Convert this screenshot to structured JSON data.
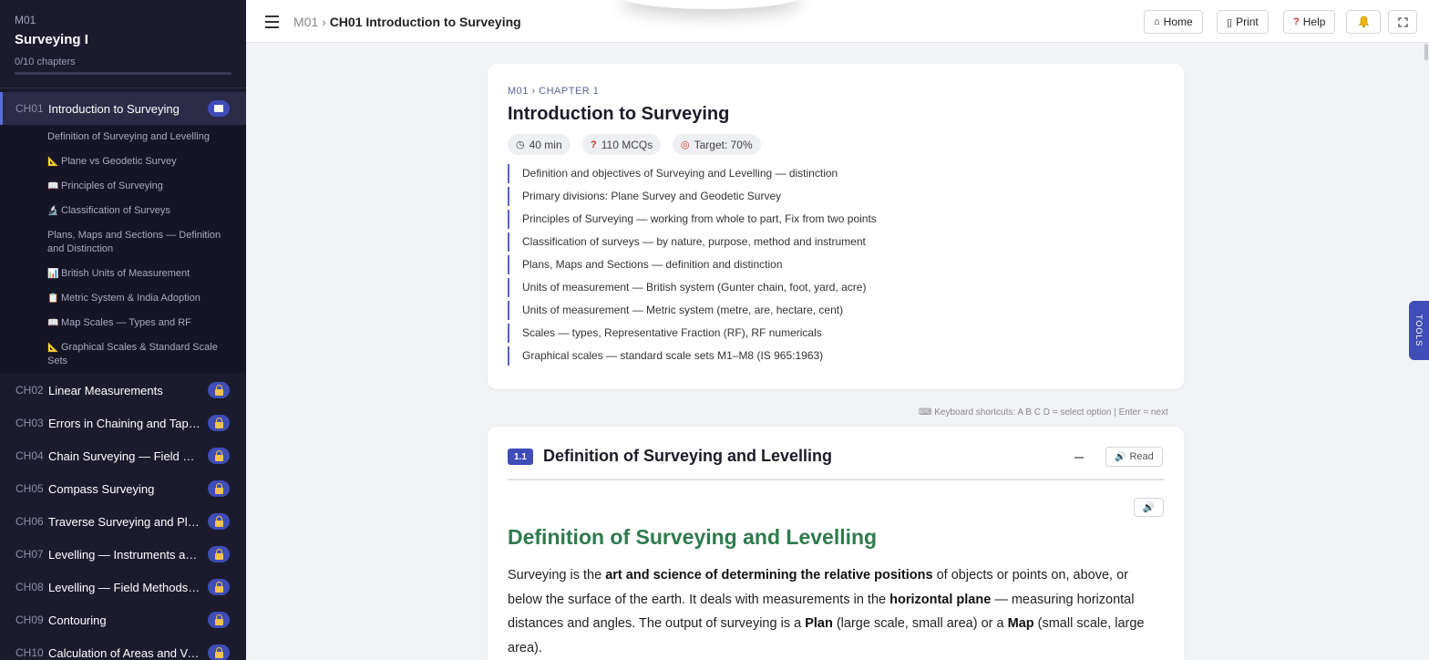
{
  "sidebar": {
    "module": "M01",
    "title": "Surveying I",
    "progress_text": "0/10 chapters",
    "progress_fraction": 0,
    "chapters": [
      {
        "code": "CH01",
        "label": "Introduction to Surveying",
        "badge": "book-icon",
        "active": true
      },
      {
        "code": "CH02",
        "label": "Linear Measurements",
        "badge": "lock-icon"
      },
      {
        "code": "CH03",
        "label": "Errors in Chaining and Tape C...",
        "badge": "lock-icon"
      },
      {
        "code": "CH04",
        "label": "Chain Surveying — Field Met...",
        "badge": "lock-icon"
      },
      {
        "code": "CH05",
        "label": "Compass Surveying",
        "badge": "lock-icon"
      },
      {
        "code": "CH06",
        "label": "Traverse Surveying and Plane ...",
        "badge": "lock-icon"
      },
      {
        "code": "CH07",
        "label": "Levelling — Instruments and ...",
        "badge": "lock-icon"
      },
      {
        "code": "CH08",
        "label": "Levelling — Field Methods an...",
        "badge": "lock-icon"
      },
      {
        "code": "CH09",
        "label": "Contouring",
        "badge": "lock-icon"
      },
      {
        "code": "CH10",
        "label": "Calculation of Areas and Volu...",
        "badge": "lock-icon"
      }
    ],
    "subtopics": [
      {
        "icon": "",
        "label": "Definition of Surveying and Levelling"
      },
      {
        "icon": "📐",
        "label": "Plane vs Geodetic Survey"
      },
      {
        "icon": "📖",
        "label": "Principles of Surveying"
      },
      {
        "icon": "🔬",
        "label": "Classification of Surveys"
      },
      {
        "icon": "",
        "label": "Plans, Maps and Sections — Definition and Distinction"
      },
      {
        "icon": "📊",
        "label": "British Units of Measurement"
      },
      {
        "icon": "📋",
        "label": "Metric System & India Adoption"
      },
      {
        "icon": "📖",
        "label": "Map Scales — Types and RF"
      },
      {
        "icon": "📐",
        "label": "Graphical Scales & Standard Scale Sets"
      }
    ]
  },
  "topbar": {
    "crumb_module": "M01",
    "crumb_sep": "›",
    "crumb_current": "CH01 Introduction to Surveying",
    "home": "Home",
    "print": "Print",
    "help": "Help",
    "icons": {
      "home": "home-icon",
      "print": "print-icon",
      "help": "help-icon",
      "bell": "bell-icon",
      "fullscreen": "fullscreen-icon"
    }
  },
  "tools_tab": "TOOLS",
  "chapter_card": {
    "kicker": "M01 › CHAPTER 1",
    "title": "Introduction to Surveying",
    "chips": {
      "duration": "40 min",
      "mcqs": "110 MCQs",
      "target": "Target: 70%"
    },
    "objectives": [
      "Definition and objectives of Surveying and Levelling — distinction",
      "Primary divisions: Plane Survey and Geodetic Survey",
      "Principles of Surveying — working from whole to part, Fix from two points",
      "Classification of surveys — by nature, purpose, method and instrument",
      "Plans, Maps and Sections — definition and distinction",
      "Units of measurement — British system (Gunter chain, foot, yard, acre)",
      "Units of measurement — Metric system (metre, are, hectare, cent)",
      "Scales — types, Representative Fraction (RF), RF numericals",
      "Graphical scales — standard scale sets M1–M8 (IS 965:1963)"
    ]
  },
  "keyboard_hint": "⌨ Keyboard shortcuts: A B C D = select option  |  Enter = next",
  "section": {
    "number": "1.1",
    "title": "Definition of Surveying and Levelling",
    "read_label": "Read",
    "heading": "Definition of Surveying and Levelling",
    "para": [
      {
        "t": "Surveying is the ",
        "b": false
      },
      {
        "t": "art and science of determining the relative positions",
        "b": true
      },
      {
        "t": " of objects or points on, above, or below the surface of the earth. It deals with measurements in the ",
        "b": false
      },
      {
        "t": "horizontal plane",
        "b": true
      },
      {
        "t": " — measuring horizontal distances and angles. The output of surveying is a ",
        "b": false
      },
      {
        "t": "Plan",
        "b": true
      },
      {
        "t": " (large scale, small area) or a ",
        "b": false
      },
      {
        "t": "Map",
        "b": true
      },
      {
        "t": " (small scale, large area).",
        "b": false
      }
    ]
  }
}
